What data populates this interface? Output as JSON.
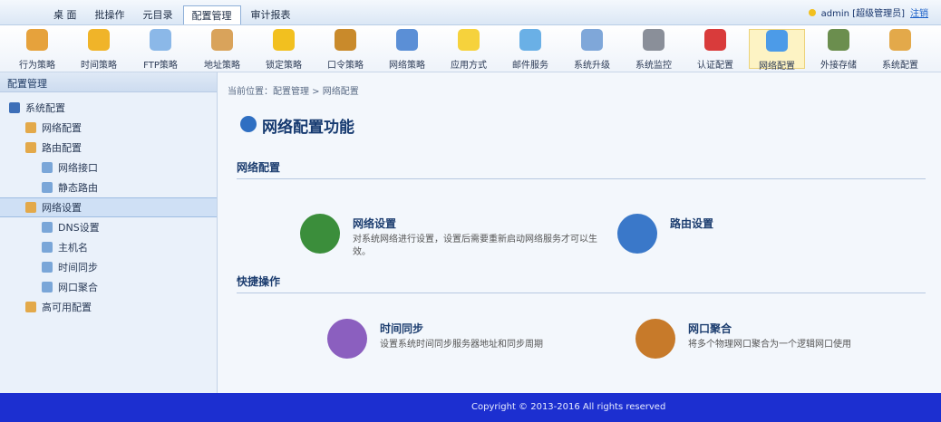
{
  "menubar": {
    "items": [
      "桌 面",
      "批操作",
      "元目录",
      "配置管理",
      "审计报表"
    ],
    "active_index": 3,
    "user_text": "admin [超级管理员]",
    "logout_label": "注销"
  },
  "toolbar": {
    "items": [
      {
        "label": "行为策略",
        "icon": "behavior-policy-icon",
        "color": "#e6a23c"
      },
      {
        "label": "时间策略",
        "icon": "time-policy-icon",
        "color": "#f0b429"
      },
      {
        "label": "FTP策略",
        "icon": "ftp-policy-icon",
        "color": "#8bb8e8"
      },
      {
        "label": "地址策略",
        "icon": "address-policy-icon",
        "color": "#d9a35b"
      },
      {
        "label": "锁定策略",
        "icon": "lock-policy-icon",
        "color": "#f2c01f"
      },
      {
        "label": "口令策略",
        "icon": "password-policy-icon",
        "color": "#c98a2b"
      },
      {
        "label": "网络策略",
        "icon": "network-policy-icon",
        "color": "#5b8fd6"
      },
      {
        "label": "应用方式",
        "icon": "app-mode-icon",
        "color": "#f6d23c"
      },
      {
        "label": "邮件服务",
        "icon": "mail-service-icon",
        "color": "#6ab0e6"
      },
      {
        "label": "系统升级",
        "icon": "system-upgrade-icon",
        "color": "#7fa7d9"
      },
      {
        "label": "系统监控",
        "icon": "system-monitor-icon",
        "color": "#8a8f99"
      },
      {
        "label": "认证配置",
        "icon": "auth-config-icon",
        "color": "#d93b3b"
      },
      {
        "label": "网络配置",
        "icon": "network-config-icon",
        "color": "#4c9be8"
      },
      {
        "label": "外接存储",
        "icon": "external-storage-icon",
        "color": "#6b8e4e"
      },
      {
        "label": "系统配置",
        "icon": "system-config-icon",
        "color": "#e3a94a"
      }
    ],
    "selected_index": 12
  },
  "sidebar": {
    "header": "配置管理",
    "tree": [
      {
        "label": "系统配置",
        "level": 1
      },
      {
        "label": "网络配置",
        "level": 2
      },
      {
        "label": "路由配置",
        "level": 2
      },
      {
        "label": "网络接口",
        "level": 3
      },
      {
        "label": "静态路由",
        "level": 3
      },
      {
        "label": "网络设置",
        "level": 2
      },
      {
        "label": "DNS设置",
        "level": 3
      },
      {
        "label": "主机名",
        "level": 3
      },
      {
        "label": "时间同步",
        "level": 3
      },
      {
        "label": "网口聚合",
        "level": 3
      },
      {
        "label": "高可用配置",
        "level": 2
      }
    ],
    "selected_index": 5
  },
  "content": {
    "breadcrumb": "当前位置：配置管理 > 网络配置",
    "title": "网络配置功能",
    "section1": {
      "head": "网络配置",
      "cards": [
        {
          "title": "网络设置",
          "desc": "对系统网络进行设置，设置后需要重新启动网络服务才可以生效。",
          "icon": "network-settings-icon",
          "color": "#3b8e3b"
        },
        {
          "title": "路由设置",
          "desc": "",
          "icon": "route-settings-icon",
          "color": "#3a78c9"
        }
      ]
    },
    "section2": {
      "head": "快捷操作",
      "cards": [
        {
          "title": "时间同步",
          "desc": "设置系统时间同步服务器地址和同步周期",
          "icon": "time-sync-icon",
          "color": "#8b5fbf"
        },
        {
          "title": "网口聚合",
          "desc": "将多个物理网口聚合为一个逻辑网口使用",
          "icon": "port-aggregation-icon",
          "color": "#c77a2a"
        }
      ]
    }
  },
  "statusbar": {
    "left": "",
    "right": "Copyright © 2013-2016 All rights reserved"
  }
}
